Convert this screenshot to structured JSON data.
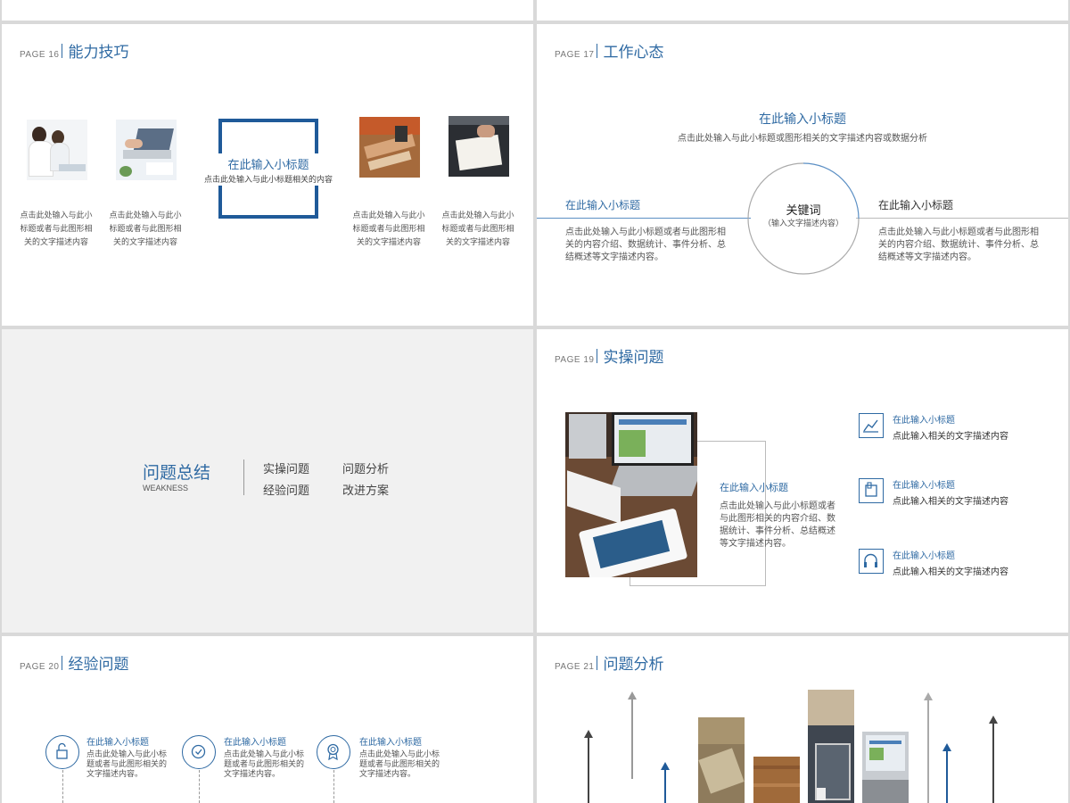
{
  "slide16": {
    "page": "PAGE 16",
    "title": "能力技巧",
    "center_title": "在此输入小标题",
    "center_desc": "点击此处输入与此小标题相关的内容",
    "captions": [
      "点击此处输入与此小标题或者与此图形相关的文字描述内容",
      "点击此处输入与此小标题或者与此图形相关的文字描述内容",
      "点击此处输入与此小标题或者与此图形相关的文字描述内容",
      "点击此处输入与此小标题或者与此图形相关的文字描述内容"
    ]
  },
  "slide17": {
    "page": "PAGE 17",
    "title": "工作心态",
    "top_title": "在此输入小标题",
    "top_desc": "点击此处输入与此小标题或图形相关的文字描述内容或数据分析",
    "left_title": "在此输入小标题",
    "left_desc": "点击此处输入与此小标题或者与此图形相关的内容介绍、数据统计、事件分析、总结概述等文字描述内容。",
    "right_title": "在此输入小标题",
    "right_desc": "点击此处输入与此小标题或者与此图形相关的内容介绍、数据统计、事件分析、总结概述等文字描述内容。",
    "keyword": "关键词",
    "keyword_sub": "（输入文字描述内容）"
  },
  "slide18": {
    "title": "问题总结",
    "subtitle": "WEAKNESS",
    "items": [
      "实操问题",
      "问题分析",
      "经验问题",
      "改进方案"
    ]
  },
  "slide19": {
    "page": "PAGE 19",
    "title": "实操问题",
    "mid_title": "在此输入小标题",
    "mid_desc": "点击此处输入与此小标题或者与此图形相关的内容介绍、数据统计、事件分析、总结概述等文字描述内容。",
    "items": [
      {
        "title": "在此输入小标题",
        "desc": "点此输入相关的文字描述内容",
        "icon": "line-chart-icon"
      },
      {
        "title": "在此输入小标题",
        "desc": "点此输入相关的文字描述内容",
        "icon": "phone-icon"
      },
      {
        "title": "在此输入小标题",
        "desc": "点此输入相关的文字描述内容",
        "icon": "headphones-icon"
      }
    ]
  },
  "slide20": {
    "page": "PAGE 20",
    "title": "经验问题",
    "items": [
      {
        "title": "在此输入小标题",
        "desc": "点击此处输入与此小标题或者与此图形相关的文字描述内容。",
        "icon": "unlock-icon"
      },
      {
        "title": "在此输入小标题",
        "desc": "点击此处输入与此小标题或者与此图形相关的文字描述内容。",
        "icon": "check-circle-icon"
      },
      {
        "title": "在此输入小标题",
        "desc": "点击此处输入与此小标题或者与此图形相关的文字描述内容。",
        "icon": "award-icon"
      }
    ]
  },
  "slide21": {
    "page": "PAGE 21",
    "title": "问题分析"
  },
  "colors": {
    "accent": "#2f6aa3",
    "frame_blue": "#1f5a99",
    "gray_bg": "#f1f1f1",
    "divider": "#d9d9d9"
  }
}
